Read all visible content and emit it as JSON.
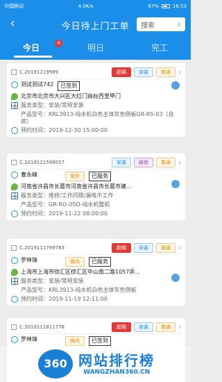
{
  "status_bar": {
    "carrier": "中国移动",
    "speed": "4.0K/s",
    "battery": "87%",
    "time": "16:53"
  },
  "app_bar": {
    "title": "今日待上门工单",
    "search_placeholder": "搜索"
  },
  "tabs": [
    {
      "label": "今日",
      "badge": "4"
    },
    {
      "label": "明日"
    },
    {
      "label": "完工"
    }
  ],
  "cards": [
    {
      "code": "C.20191219989",
      "tags": [
        "超期",
        "安装",
        "普通"
      ],
      "name": "测试测试742",
      "stamp": "已签到",
      "address": "北京市北京市大兴区大红门商标西里甲门",
      "service": "服务类型：安装/常规安装",
      "product": "产品型号：KRL3913-纯水机白色主体灰色侧板GR-R5-03（自故）",
      "time": "预约时间：2019-12-30 15:00:00"
    },
    {
      "code": "C.2019121599557",
      "tags": [
        "安装",
        "报修",
        "普通"
      ],
      "name": "曹永峰",
      "tag_inline": "保外",
      "stamp": "已服务",
      "address": "河南省许昌市长葛市河南省许昌市长葛市建...",
      "service": "服务类型：维修/工作问题/漏电不工作",
      "product": "产品型号：GR-RO-05D-纯水机整机",
      "time": "预约时间：2019-11-22 08:00:00"
    },
    {
      "code": "C.2019111799783",
      "tags": [
        "超期",
        "安装",
        "普通"
      ],
      "name": "罗林锋",
      "tag_inline": "保内",
      "stamp": "已服务",
      "address": "上海市上海市徐汇区徐汇区中山南二路1057弄...",
      "service": "服务类型：安装/常规安装",
      "product": "产品型号：KRL3913-纯水机白色主体灰色侧板",
      "time": "预约时间：2019-11-19 12:11:00"
    },
    {
      "code": "C.2019111811778",
      "tags": [
        "超期",
        "安装",
        "普通"
      ],
      "name": "罗林锋",
      "tag_inline": "保内",
      "stamp": "已签到"
    }
  ],
  "watermark": {
    "logo": "360",
    "text": "网站排行榜",
    "url": "WANGZHAN360.CN"
  }
}
